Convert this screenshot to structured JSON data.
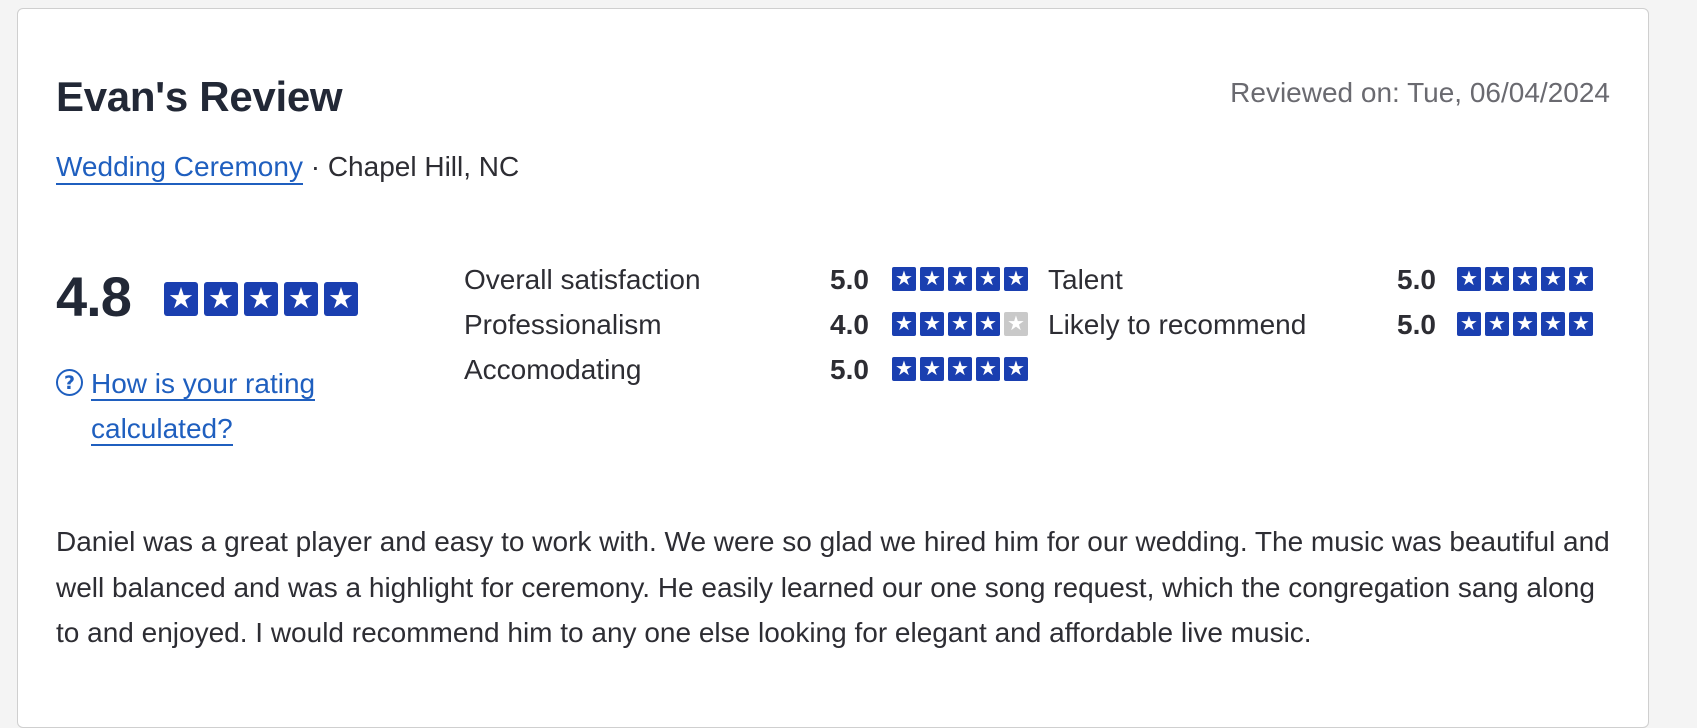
{
  "review": {
    "title": "Evan's Review",
    "reviewed_on": "Reviewed on: Tue, 06/04/2024",
    "category_link": "Wedding Ceremony",
    "location": " · Chapel Hill, NC",
    "overall_score": "4.8",
    "overall_stars": 5,
    "help_link": "How is your rating calculated?",
    "ratings": [
      {
        "label": "Overall satisfaction",
        "value": "5.0",
        "stars": 5
      },
      {
        "label": "Professionalism",
        "value": "4.0",
        "stars": 4
      },
      {
        "label": "Accomodating",
        "value": "5.0",
        "stars": 5
      },
      {
        "label": "Talent",
        "value": "5.0",
        "stars": 5
      },
      {
        "label": "Likely to recommend",
        "value": "5.0",
        "stars": 5
      }
    ],
    "body": "Daniel was a great player and easy to work with. We were so glad we hired him for our wedding. The music was beautiful and well balanced and was a highlight for ceremony. He easily learned our one song request, which the congregation sang along to and enjoyed. I would recommend him to any one else looking for elegant and affordable live music."
  },
  "colors": {
    "star_on": "#1a3fb0",
    "star_off": "#c9c9c9",
    "link": "#1f5fbf"
  },
  "icons": {
    "star": "star-icon",
    "help": "question-circle-icon"
  }
}
